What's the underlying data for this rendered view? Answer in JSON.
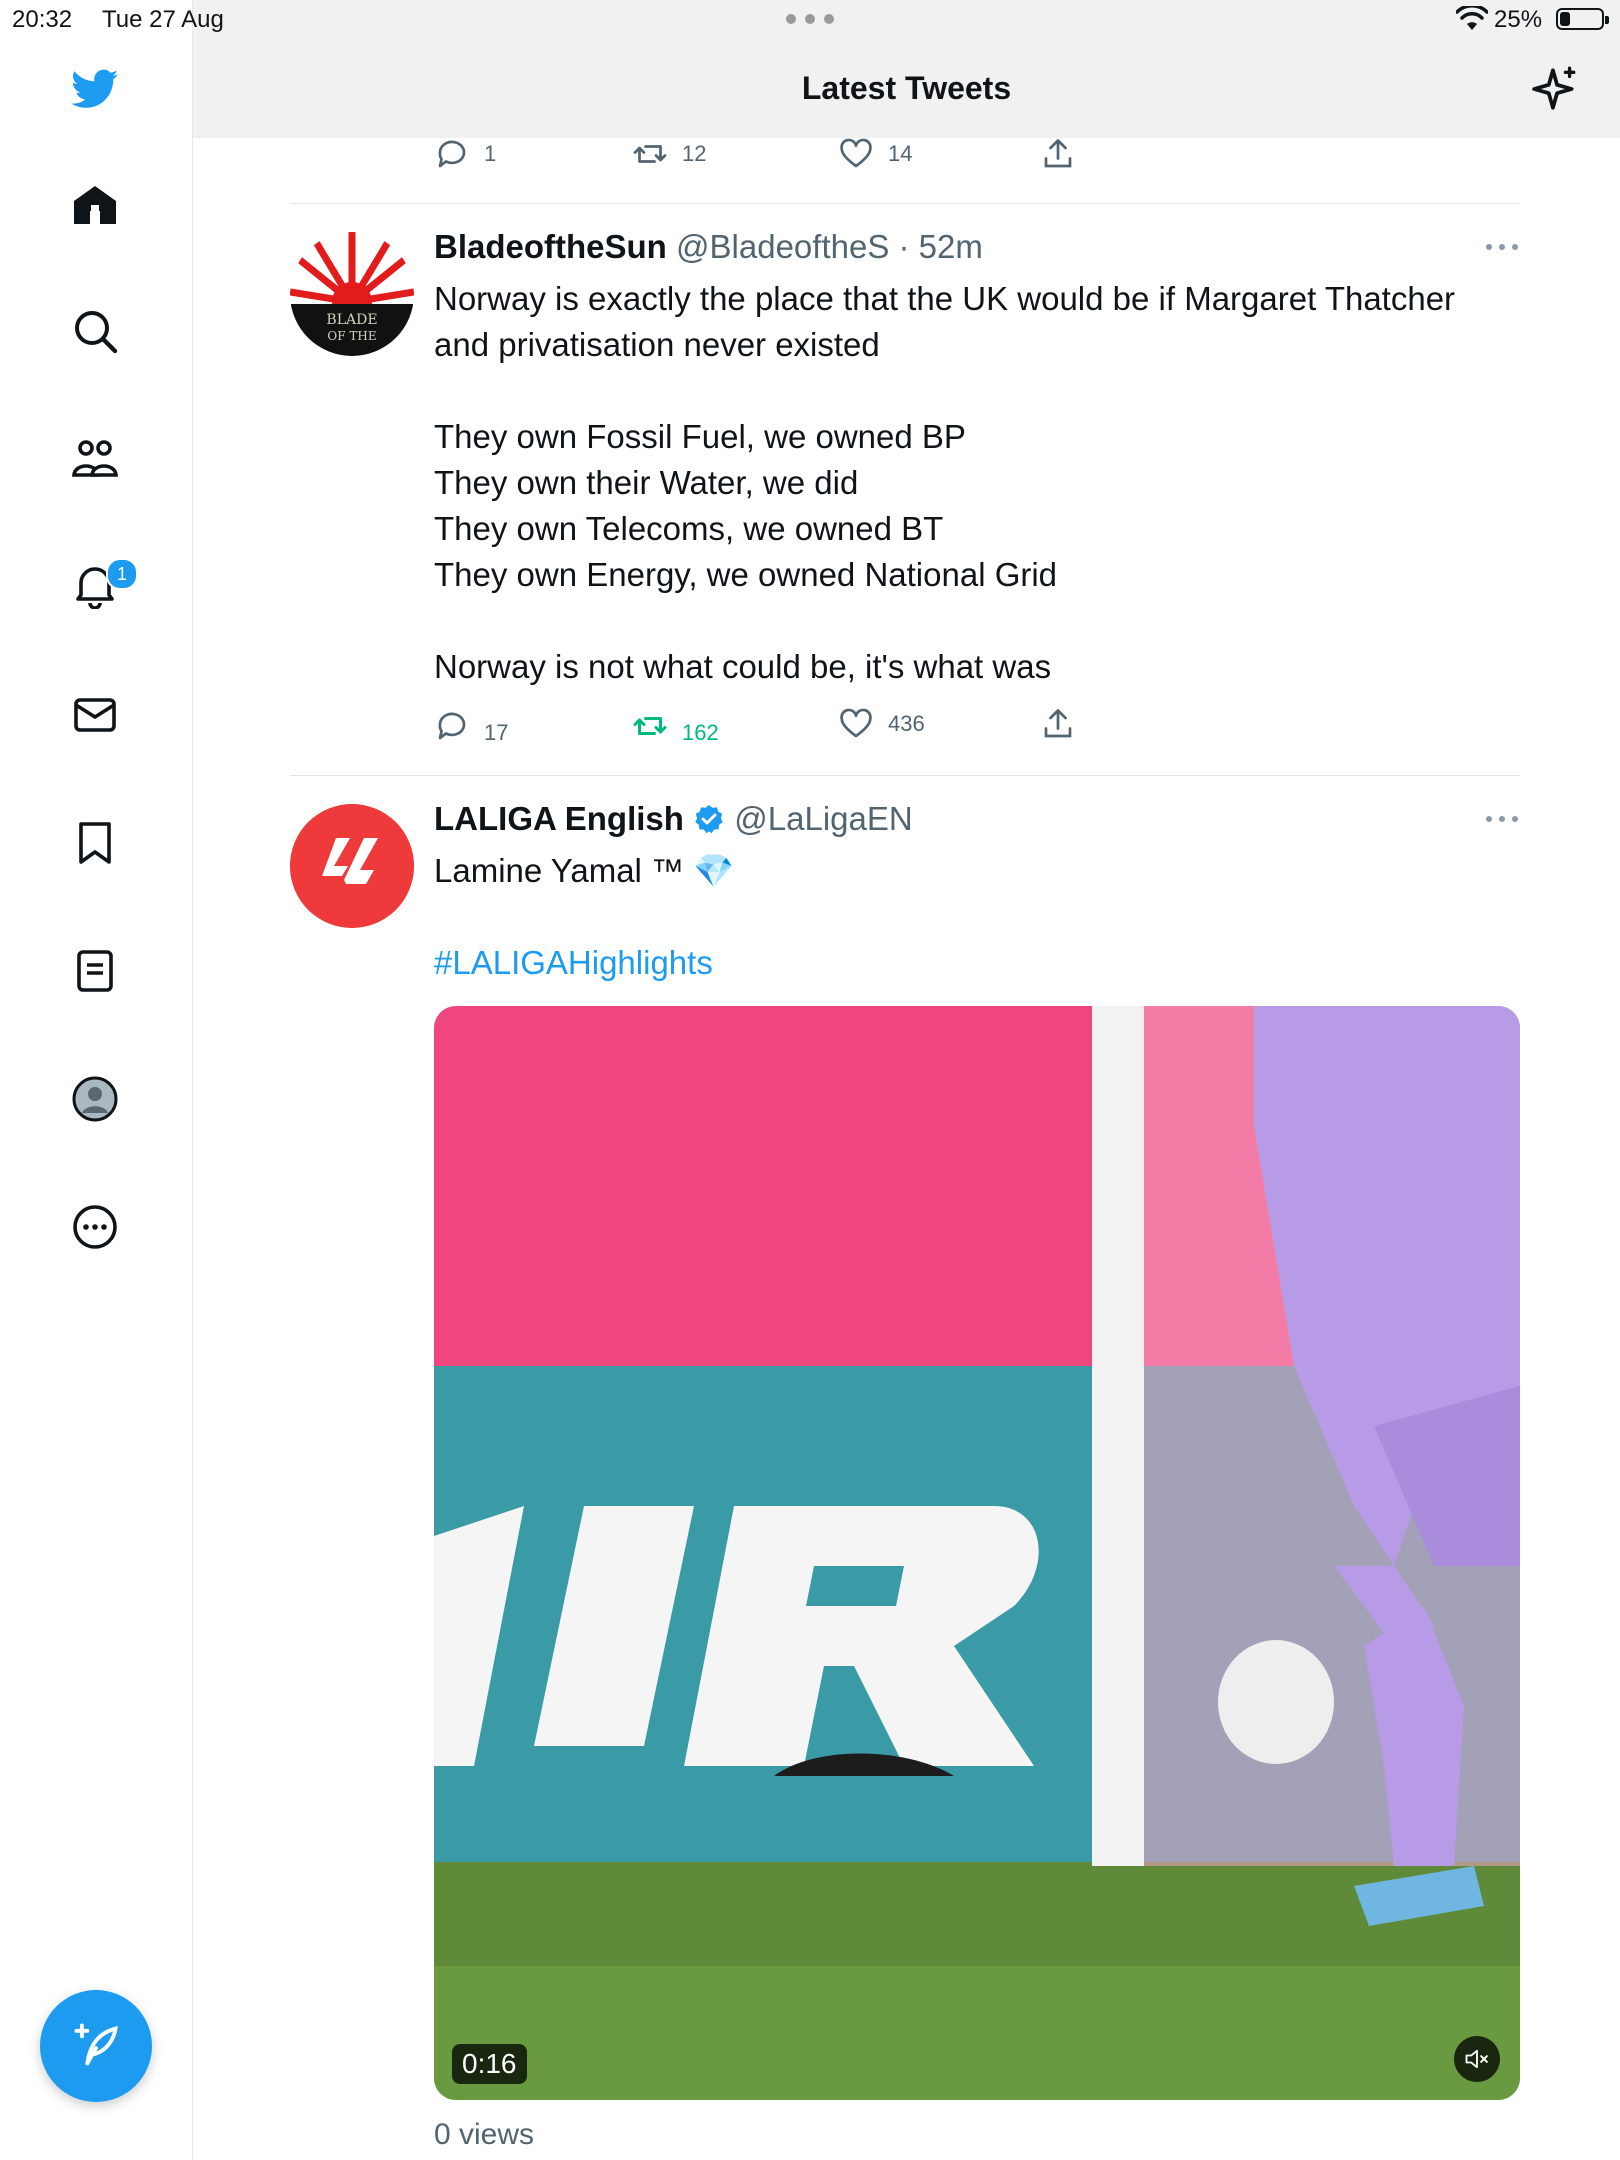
{
  "status_bar": {
    "time": "20:32",
    "date": "Tue 27 Aug",
    "battery": "25%",
    "battery_level": 0.25
  },
  "header": {
    "title": "Latest Tweets",
    "sparkle_icon": "sparkle-icon"
  },
  "sidebar": {
    "logo_icon": "twitter-bird-icon",
    "items": [
      {
        "name": "home",
        "icon": "home-icon"
      },
      {
        "name": "explore",
        "icon": "search-icon"
      },
      {
        "name": "communities",
        "icon": "people-icon"
      },
      {
        "name": "notifications",
        "icon": "bell-icon",
        "badge": "1"
      },
      {
        "name": "messages",
        "icon": "mail-icon"
      },
      {
        "name": "bookmarks",
        "icon": "bookmark-icon"
      },
      {
        "name": "lists",
        "icon": "list-icon"
      },
      {
        "name": "profile",
        "icon": "avatar-icon"
      },
      {
        "name": "more",
        "icon": "more-circle-icon"
      }
    ],
    "compose_icon": "compose-feather-icon"
  },
  "previous_tweet": {
    "replies": "1",
    "retweets": "12",
    "likes": "14"
  },
  "tweets": [
    {
      "name": "BladeoftheSun",
      "handle": "@BladeoftheS",
      "time": "· 52m",
      "avatar_text_1": "BLADE",
      "avatar_text_2": "OF THE",
      "lines": [
        "Norway is exactly the place that the UK would be if Margaret Thatcher",
        "and privatisation never existed",
        "",
        "They own Fossil Fuel, we owned BP",
        "They own their Water, we did",
        "They own Telecoms, we owned BT",
        "They own Energy, we owned National Grid",
        "",
        "Norway is not what could be, it's what was"
      ],
      "replies": "17",
      "retweets": "162",
      "likes": "436",
      "retweeted": true
    },
    {
      "name": "LALIGA English",
      "verified": true,
      "handle": "@LaLigaEN",
      "text": "Lamine Yamal ™ ",
      "emoji": "💎",
      "hashtag": "#LALIGAHighlights",
      "video_duration": "0:16",
      "views": "0 views"
    }
  ],
  "colors": {
    "accent": "#1d9bf0",
    "retweet_green": "#00ba7c",
    "laliga_red": "#ee3a3a"
  }
}
